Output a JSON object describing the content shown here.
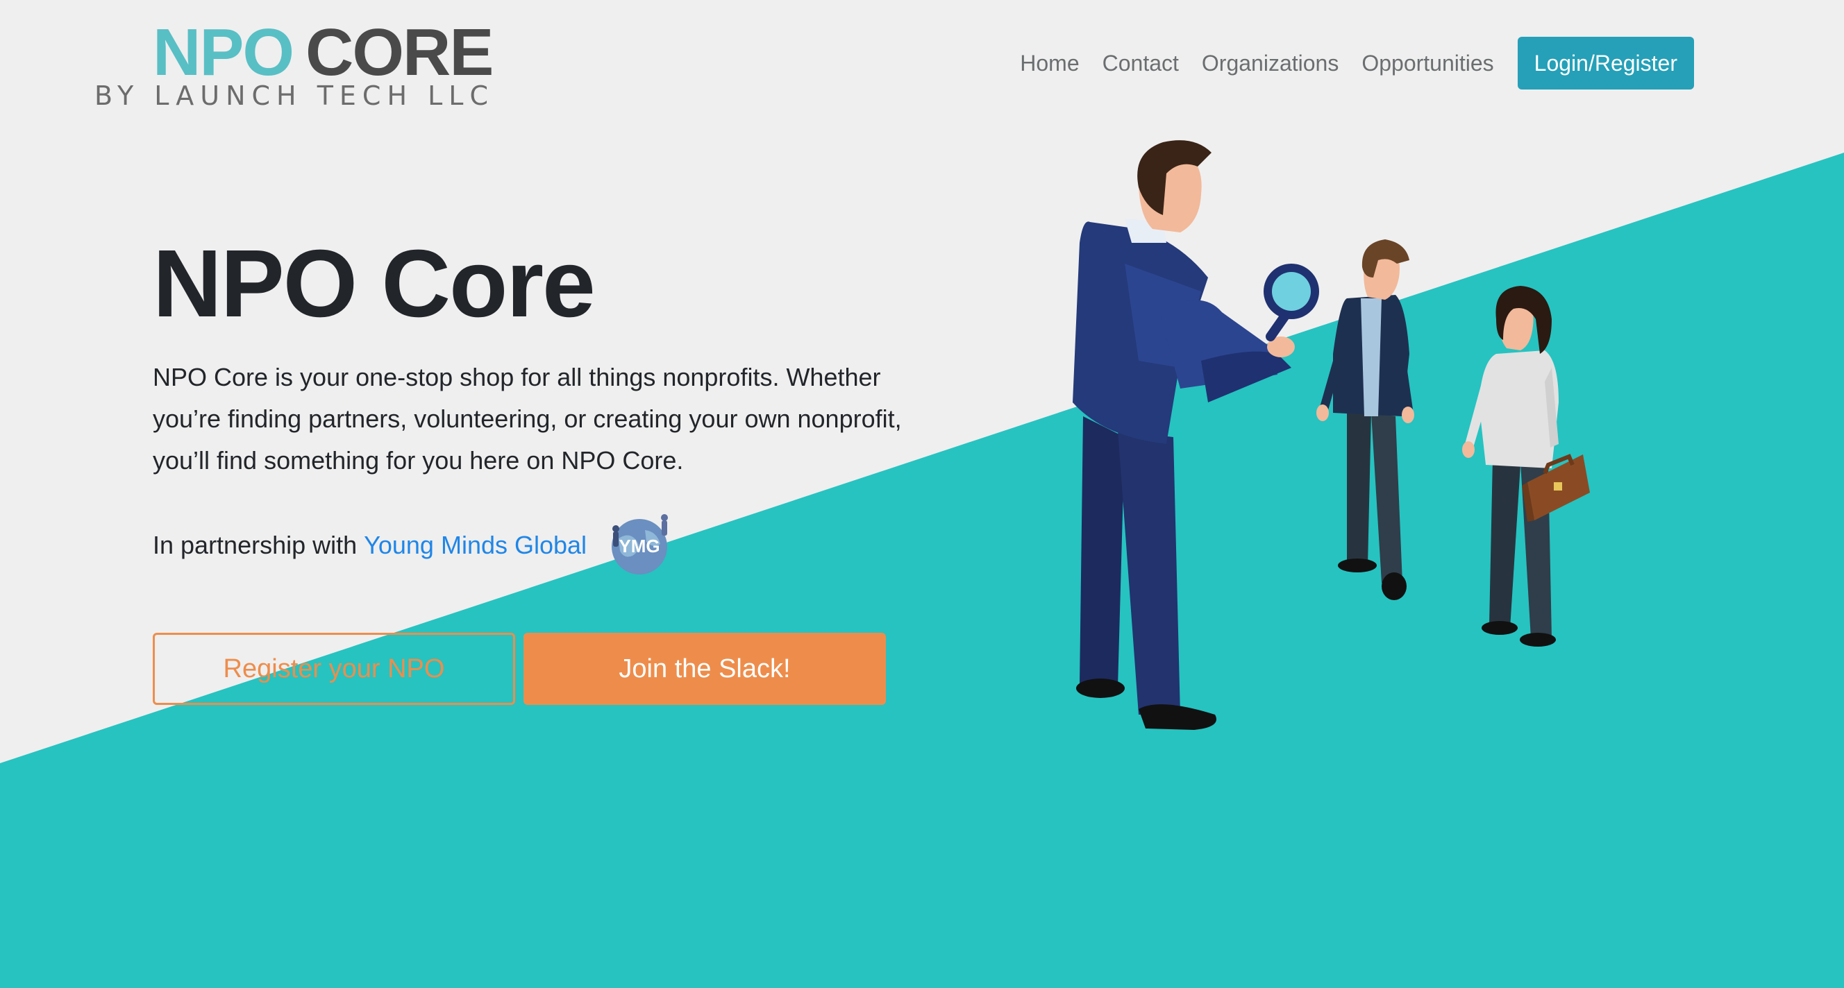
{
  "colors": {
    "background": "#efefef",
    "teal": "#26c3c1",
    "brand_teal": "#58bfc5",
    "button_teal": "#25a0b8",
    "orange": "#ee8d4b",
    "link_blue": "#1f86e8"
  },
  "logo": {
    "part1": "NPO",
    "part2": "CORE",
    "tagline": "BY LAUNCH TECH LLC"
  },
  "nav": {
    "items": [
      "Home",
      "Contact",
      "Organizations",
      "Opportunities"
    ],
    "login_label": "Login/Register"
  },
  "hero": {
    "title": "NPO Core",
    "description": "NPO Core is your one-stop shop for all things nonprofits. Whether you’re finding partners, volunteering, or creating your own nonprofit, you’ll find something for you here on NPO Core.",
    "partner_prefix": "In partnership with",
    "partner_name": "Young Minds Global",
    "partner_logo_text": "YMG"
  },
  "buttons": {
    "register_label": "Register your NPO",
    "slack_label": "Join the Slack!"
  },
  "icons": {
    "partner_logo": "ymg-globe-logo",
    "illustration": "business-people-magnifier-illustration"
  }
}
